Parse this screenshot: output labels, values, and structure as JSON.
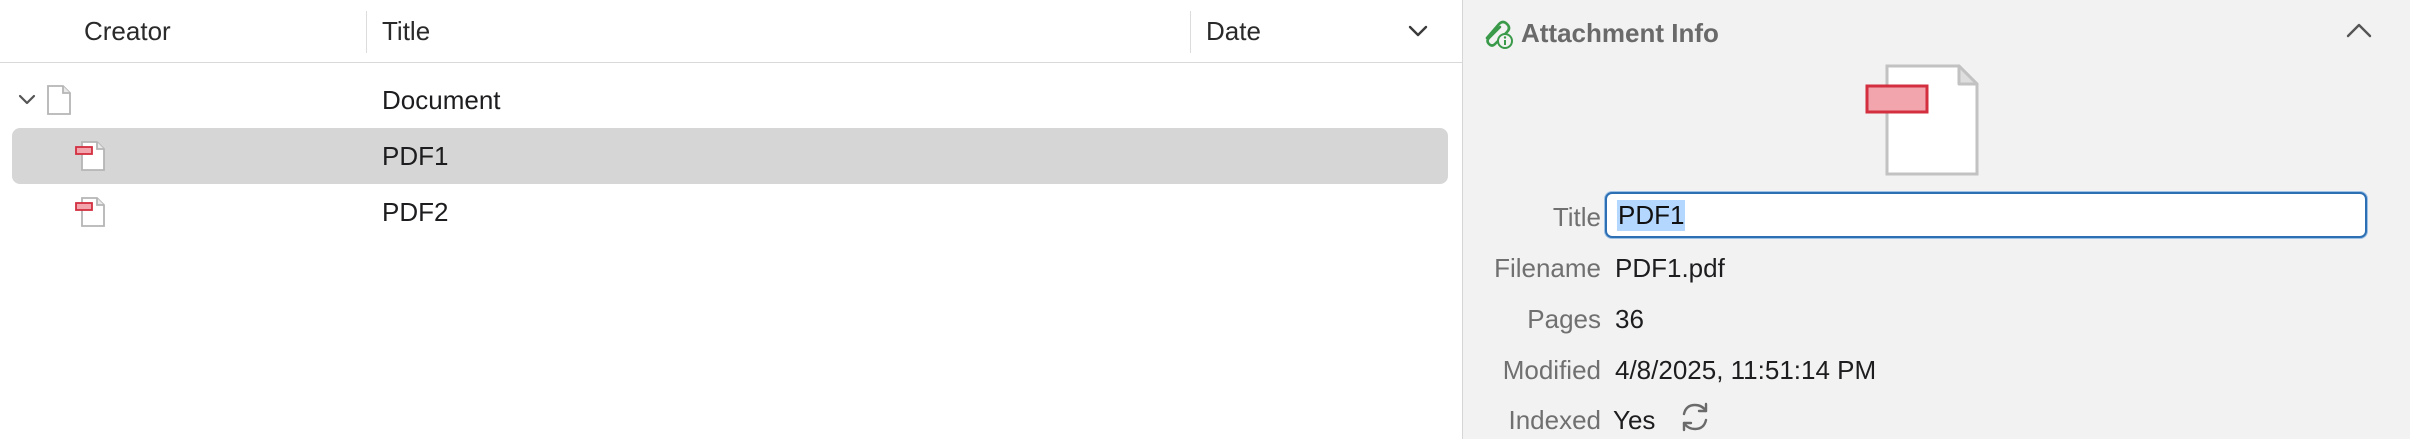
{
  "columns": {
    "creator": "Creator",
    "title": "Title",
    "date": "Date"
  },
  "rows": [
    {
      "title": "Document"
    },
    {
      "title": "PDF1"
    },
    {
      "title": "PDF2"
    }
  ],
  "info": {
    "header": "Attachment Info",
    "fields": {
      "title_label": "Title",
      "title_value": "PDF1",
      "filename_label": "Filename",
      "filename_value": "PDF1.pdf",
      "pages_label": "Pages",
      "pages_value": "36",
      "modified_label": "Modified",
      "modified_value": "4/8/2025, 11:51:14 PM",
      "indexed_label": "Indexed",
      "indexed_value": "Yes"
    }
  },
  "icons": {
    "twisty": "chevron-down-icon",
    "document": "document-icon",
    "pdf": "pdf-icon",
    "attachment": "paperclip-info-icon",
    "collapse": "chevron-up-icon",
    "reindex": "refresh-icon",
    "sort": "chevron-down-icon"
  },
  "colors": {
    "selection": "#d6d6d6",
    "pdf_red": "#d32f3f",
    "focus_ring": "#2d6fb3",
    "text_selection": "#b3d7ff",
    "attachment_icon": "#3a9a4a"
  }
}
